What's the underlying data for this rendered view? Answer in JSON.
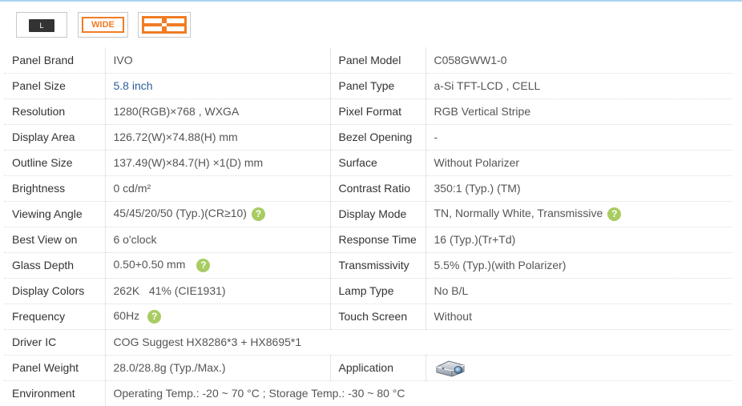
{
  "badges": {
    "l_label": "L",
    "wide_label": "WIDE"
  },
  "rows": [
    {
      "label": "Panel Brand",
      "value": "IVO",
      "label2": "Panel Model",
      "value2": "C058GWW1-0"
    },
    {
      "label": "Panel Size",
      "value": "5.8 inch",
      "label2": "Panel Type",
      "value2": "a-Si TFT-LCD , CELL"
    },
    {
      "label": "Resolution",
      "value": "1280(RGB)×768 , WXGA",
      "label2": "Pixel Format",
      "value2": "RGB Vertical Stripe"
    },
    {
      "label": "Display Area",
      "value": "126.72(W)×74.88(H) mm",
      "label2": "Bezel Opening",
      "value2": "-"
    },
    {
      "label": "Outline Size",
      "value": "137.49(W)×84.7(H) ×1(D) mm",
      "label2": "Surface",
      "value2": "Without Polarizer"
    },
    {
      "label": "Brightness",
      "value": "0 cd/m²",
      "label2": "Contrast Ratio",
      "value2": "350:1 (Typ.) (TM)"
    },
    {
      "label": "Viewing Angle",
      "value": "45/45/20/50 (Typ.)(CR≥10)",
      "label2": "Display Mode",
      "value2": "TN, Normally White, Transmissive"
    },
    {
      "label": "Best View on",
      "value": "6 o'clock",
      "label2": "Response Time",
      "value2": "16 (Typ.)(Tr+Td)"
    },
    {
      "label": "Glass Depth",
      "value": "0.50+0.50 mm",
      "label2": "Transmissivity",
      "value2": "5.5% (Typ.)(with Polarizer)"
    },
    {
      "label": "Display Colors",
      "value": "262K   41% (CIE1931)",
      "label2": "Lamp Type",
      "value2": "No B/L"
    },
    {
      "label": "Frequency",
      "value": "60Hz",
      "label2": "Touch Screen",
      "value2": "Without"
    },
    {
      "label": "Driver IC",
      "value": "COG Suggest HX8286*3 + HX8695*1"
    },
    {
      "label": "Panel Weight",
      "value": "28.0/28.8g (Typ./Max.)",
      "label2": "Application",
      "app_icon": "projector-icon"
    },
    {
      "label": "Environment",
      "value": "Operating Temp.: -20 ~ 70 °C ; Storage Temp.: -30 ~ 80 °C"
    }
  ],
  "help_glyph": "?",
  "colors": {
    "accent_orange": "#f07c24",
    "help_green": "#a8cc62",
    "link_blue": "#2c5f9a",
    "top_line": "#a9d4ef"
  }
}
